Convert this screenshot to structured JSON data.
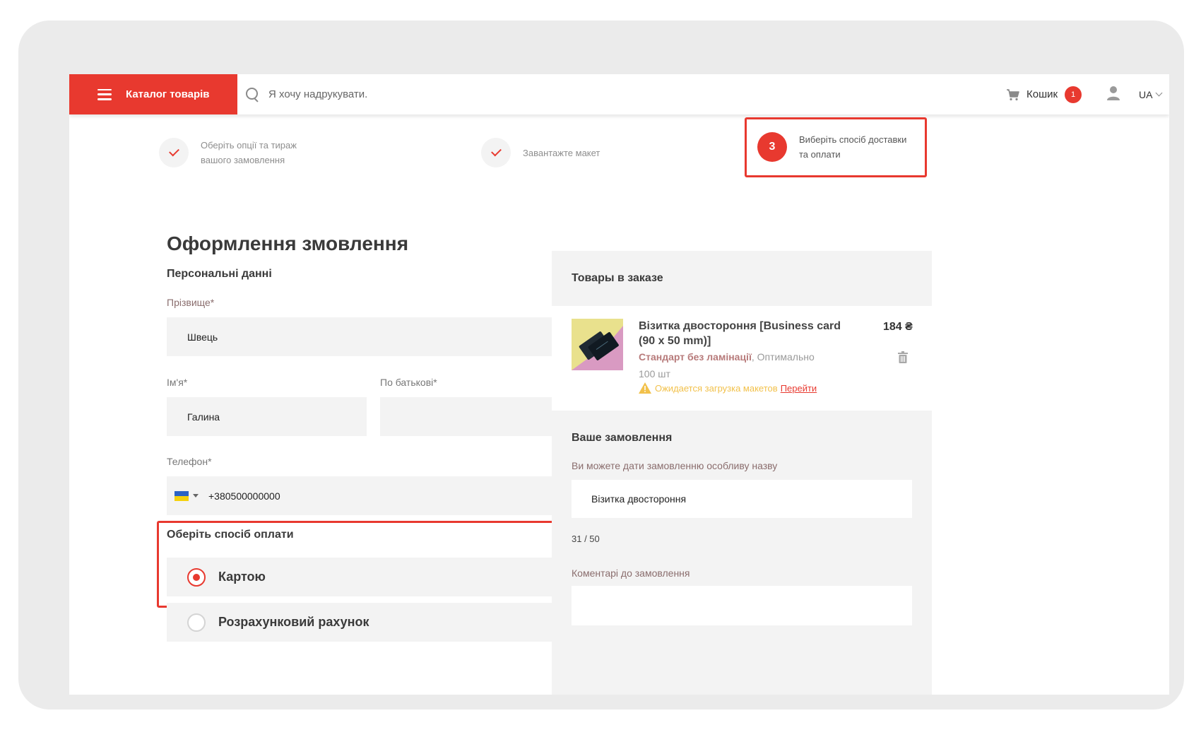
{
  "header": {
    "catalog_label": "Каталог товарів",
    "search_placeholder": "Я хочу надрукувати.",
    "cart_label": "Кошик",
    "cart_count": "1",
    "language": "UA"
  },
  "steps": [
    {
      "line1": "Оберіть опції та тираж",
      "line2": "вашого замовлення",
      "state": "done"
    },
    {
      "line1": "Завантажте макет",
      "line2": "",
      "state": "done"
    },
    {
      "number": "3",
      "line1": "Виберіть спосіб доставки",
      "line2": "та оплати",
      "state": "active"
    }
  ],
  "form": {
    "page_title": "Оформлення змовлення",
    "personal_title": "Персональні данні",
    "surname_label": "Прізвище*",
    "surname_value": "Швець",
    "name_label": "Ім'я*",
    "name_value": "Галина",
    "patronymic_label": "По батькові*",
    "patronymic_value": "",
    "phone_label": "Телефон*",
    "phone_value": "+380500000000",
    "payment_title": "Оберіть спосіб оплати",
    "payment_options": [
      {
        "label": "Картою",
        "selected": true
      },
      {
        "label": "Розрахунковий рахунок",
        "selected": false
      }
    ]
  },
  "order_items": {
    "title": "Товары в заказе",
    "product": {
      "name": "Візитка двостороння [Business card (90 x 50 mm)]",
      "price": "184 ₴",
      "option_bold": "Стандарт без ламінації",
      "option_rest": ", Оптимально",
      "quantity": "100 шт",
      "warning": "Ожидается загрузка макетов",
      "warning_link": "Перейти"
    }
  },
  "order": {
    "title": "Ваше замовлення",
    "name_hint": "Ви можете дати замовленню особливу назву",
    "name_value": "Візитка двостороння",
    "counter": "31 / 50",
    "comment_label": "Коментарі до замовлення"
  },
  "colors": {
    "accent": "#e8392f",
    "panel_bg": "#f3f3f3",
    "frame_bg": "#ebebeb",
    "warning": "#f2c14b"
  },
  "icons": [
    "menu-icon",
    "search-icon",
    "cart-icon",
    "user-icon",
    "chevron-down-icon",
    "check-icon",
    "trash-icon",
    "warning-icon",
    "ukraine-flag-icon"
  ]
}
